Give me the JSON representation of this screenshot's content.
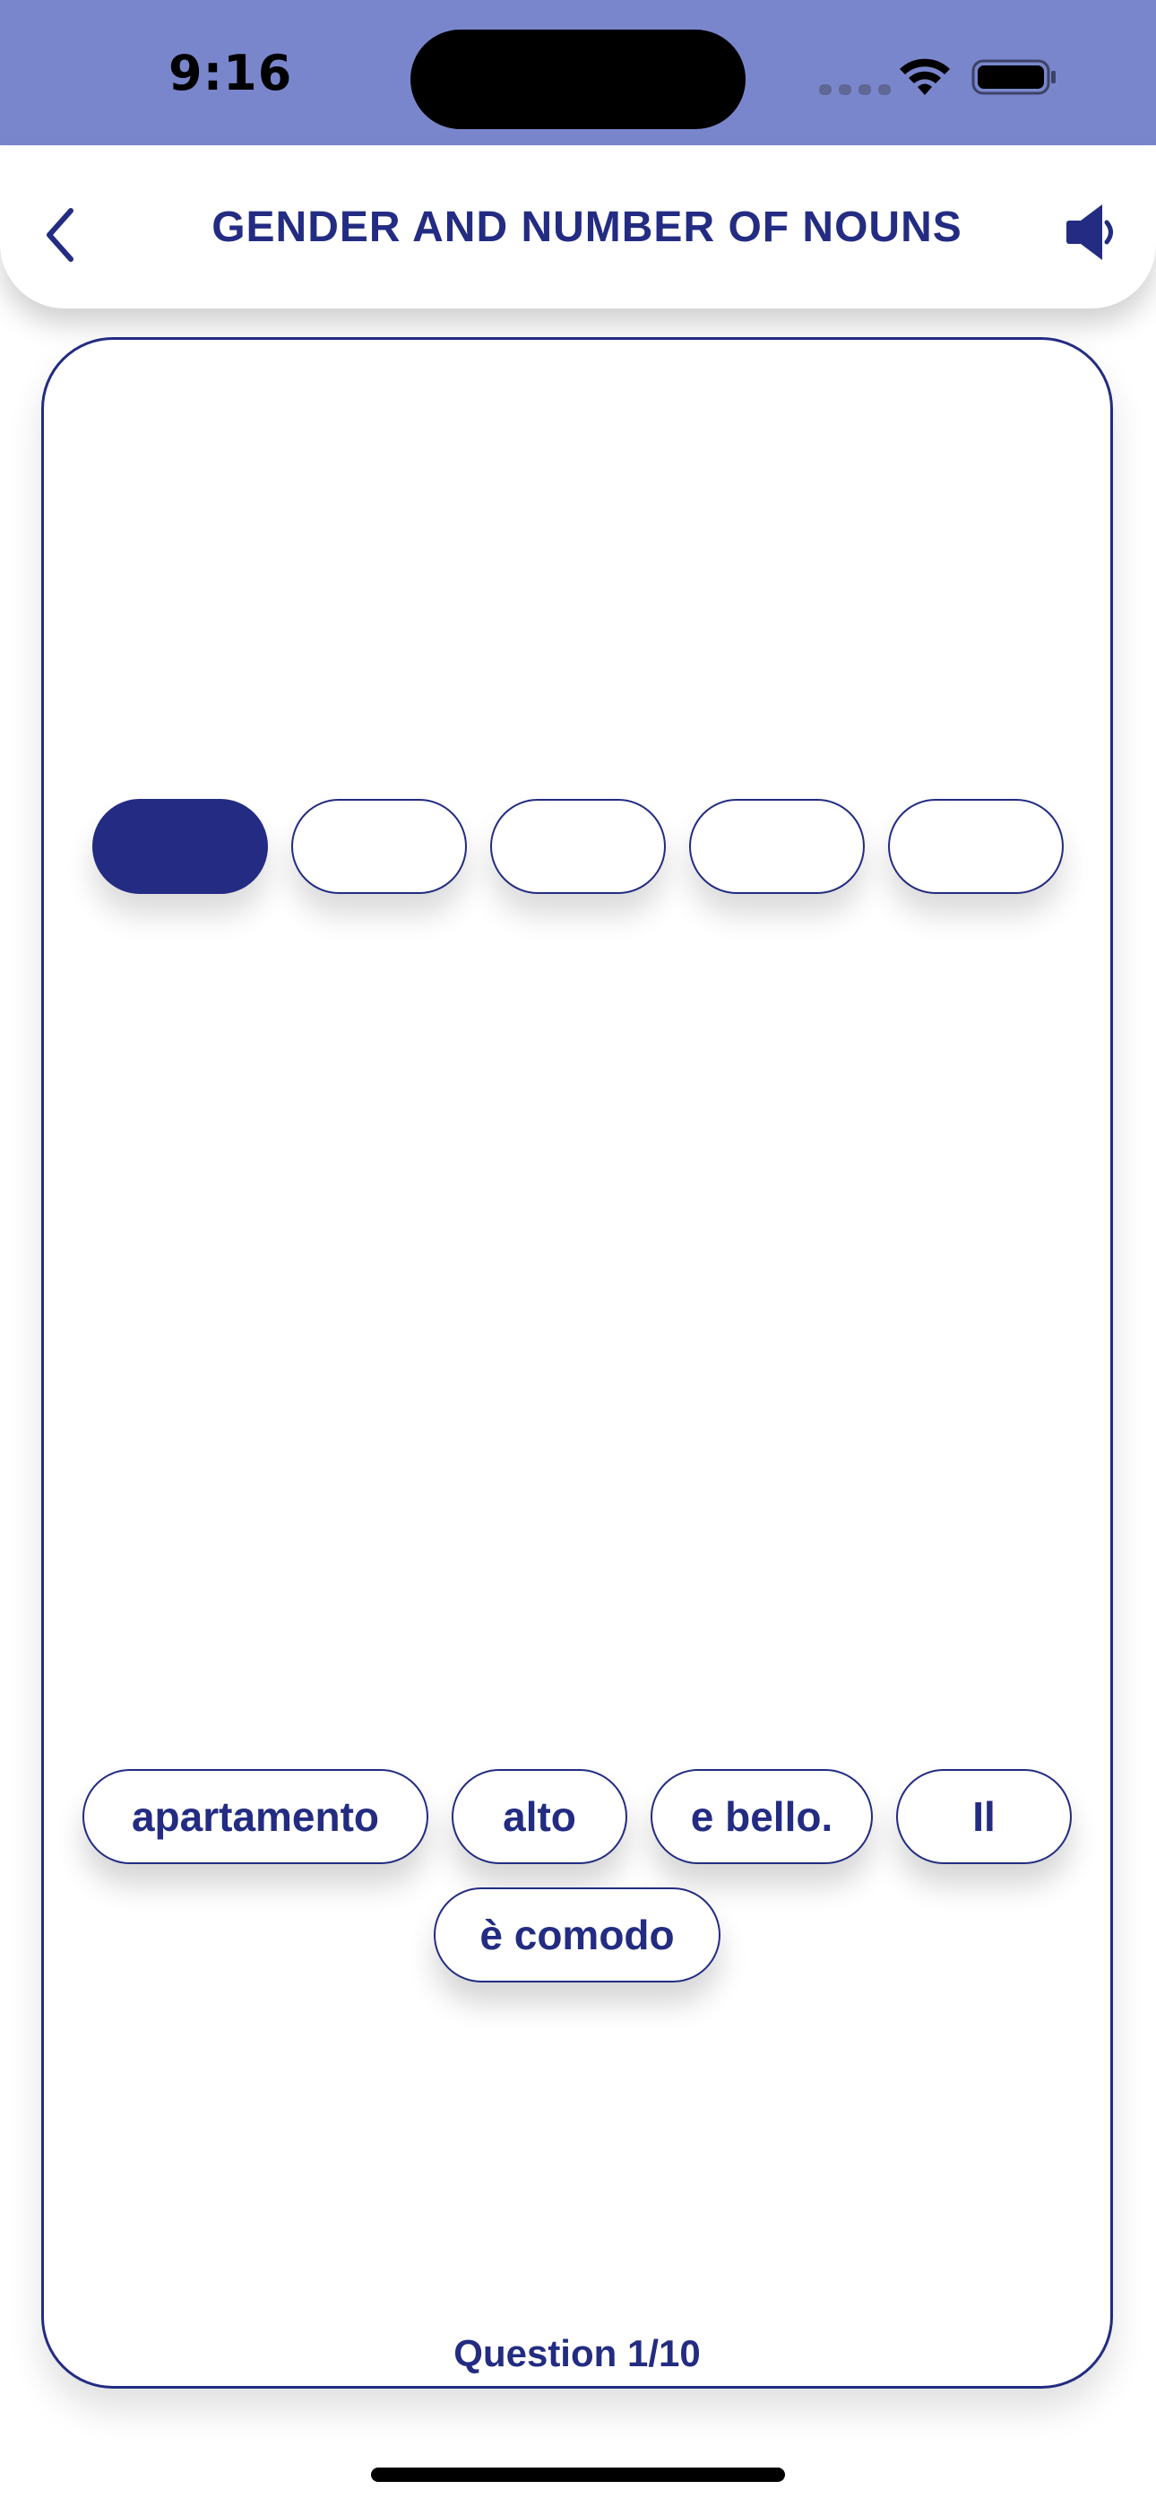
{
  "status_bar": {
    "time": "9:16",
    "background": "#7a86cc",
    "icons": [
      "signal-icon",
      "wifi-icon",
      "battery-icon"
    ]
  },
  "header": {
    "title": "GENDER AND NUMBER OF NOUNS",
    "back_icon": "chevron-left-icon",
    "sound_icon": "speaker-icon",
    "accent": "#232c82"
  },
  "exercise": {
    "slot_count": 5,
    "filled_slots": 1,
    "word_bank": [
      [
        "apartamento",
        "alto",
        "e bello.",
        "Il"
      ],
      [
        "è comodo"
      ]
    ],
    "question_label": "Question 1/10"
  }
}
